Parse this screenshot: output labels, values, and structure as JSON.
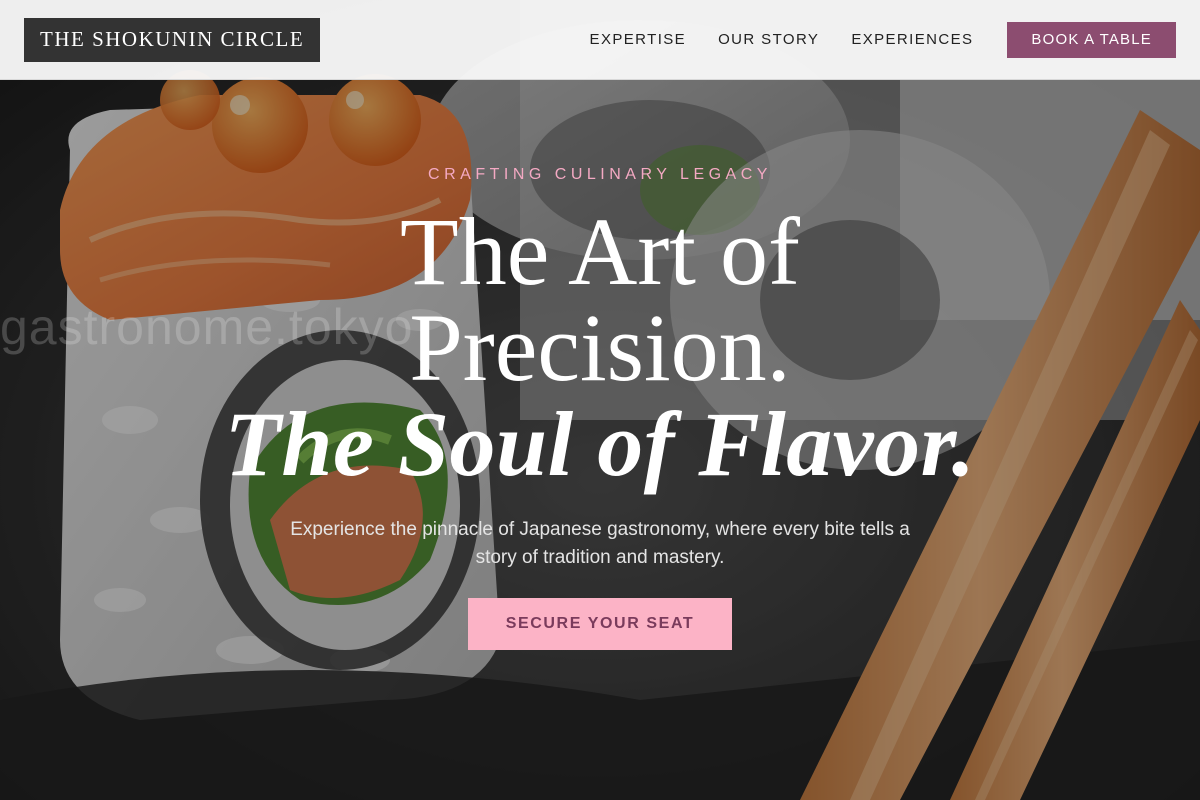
{
  "header": {
    "logo_text": "THE SHOKUNIN CIRCLE",
    "nav": [
      {
        "label": "EXPERTISE"
      },
      {
        "label": "OUR STORY"
      },
      {
        "label": "EXPERIENCES"
      }
    ],
    "book_button_label": "BOOK A TABLE"
  },
  "hero": {
    "eyebrow": "CRAFTING CULINARY LEGACY",
    "headline_line1": "The Art of",
    "headline_line2": "Precision.",
    "headline_line3": "The Soul of Flavor.",
    "subtitle": "Experience the pinnacle of Japanese gastronomy, where every bite tells a story of tradition and mastery.",
    "cta_label": "SECURE YOUR SEAT",
    "watermark": "gastronome.tokyo",
    "background_image": "sushi roll with salmon and roe beside wooden chopsticks"
  },
  "colors": {
    "accent": "#8c4d70",
    "cta_background": "#fcb3c6",
    "eyebrow_pink": "#f4a9c3",
    "header_background": "#f8f8f8",
    "logo_background": "#333333"
  }
}
